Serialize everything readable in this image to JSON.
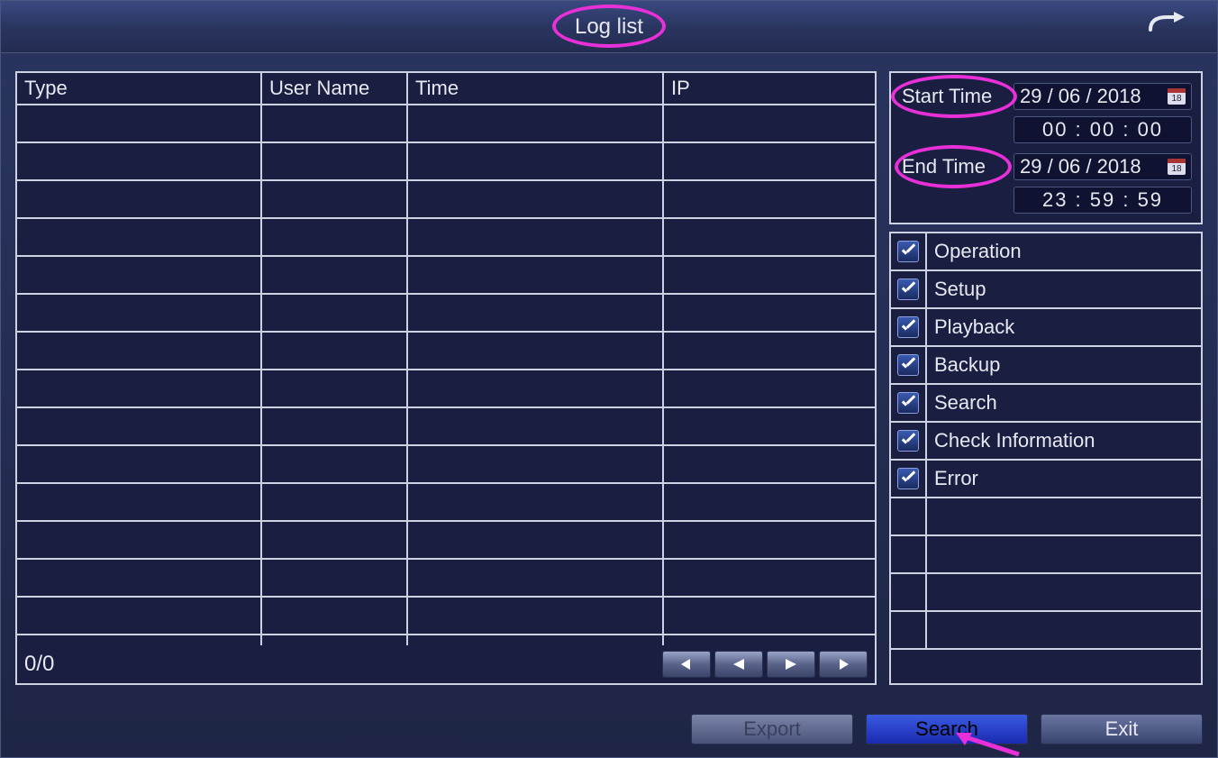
{
  "title": "Log list",
  "columns": {
    "type": "Type",
    "user": "User Name",
    "time": "Time",
    "ip": "IP"
  },
  "rows": [],
  "pageInfo": "0/0",
  "startTime": {
    "label": "Start Time",
    "date": "29 / 06 / 2018",
    "time": "00 : 00 : 00",
    "calDay": "18"
  },
  "endTime": {
    "label": "End Time",
    "date": "29 / 06 / 2018",
    "time": "23 : 59 : 59",
    "calDay": "18"
  },
  "filters": [
    {
      "label": "Operation",
      "checked": true
    },
    {
      "label": "Setup",
      "checked": true
    },
    {
      "label": "Playback",
      "checked": true
    },
    {
      "label": "Backup",
      "checked": true
    },
    {
      "label": "Search",
      "checked": true
    },
    {
      "label": "Check Information",
      "checked": true
    },
    {
      "label": "Error",
      "checked": true
    }
  ],
  "buttons": {
    "export": "Export",
    "search": "Search",
    "exit": "Exit"
  },
  "annotations": {
    "titleCircled": true,
    "startTimeCircled": true,
    "endTimeCircled": true,
    "searchArrow": true,
    "color": "#e830d8"
  }
}
